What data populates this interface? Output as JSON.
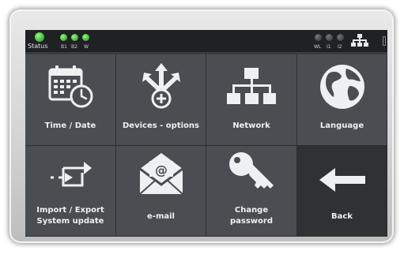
{
  "status_bar": {
    "status_label": "Status",
    "left_indicators": [
      "B1",
      "B2",
      "W"
    ],
    "right_indicators": [
      "WL",
      "I1",
      "I2"
    ]
  },
  "tiles": [
    {
      "label": "Time / Date",
      "icon": "calendar-clock-icon"
    },
    {
      "label": "Devices - options",
      "icon": "arrows-plus-icon"
    },
    {
      "label": "Network",
      "icon": "network-tree-icon"
    },
    {
      "label": "Language",
      "icon": "globe-icon"
    },
    {
      "label_line1": "Import / Export",
      "label_line2": "System update",
      "icon": "sync-arrows-icon"
    },
    {
      "label": "e-mail",
      "icon": "envelope-at-icon"
    },
    {
      "label_line1": "Change",
      "label_line2": "password",
      "icon": "key-icon"
    },
    {
      "label": "Back",
      "icon": "arrow-left-icon"
    }
  ],
  "colors": {
    "screen_bg": "#3a3d41",
    "tile_bg": "#4a4d52",
    "status_bar_bg": "#1f2124",
    "led_green": "#4bc43d",
    "text": "#eef0f2"
  }
}
